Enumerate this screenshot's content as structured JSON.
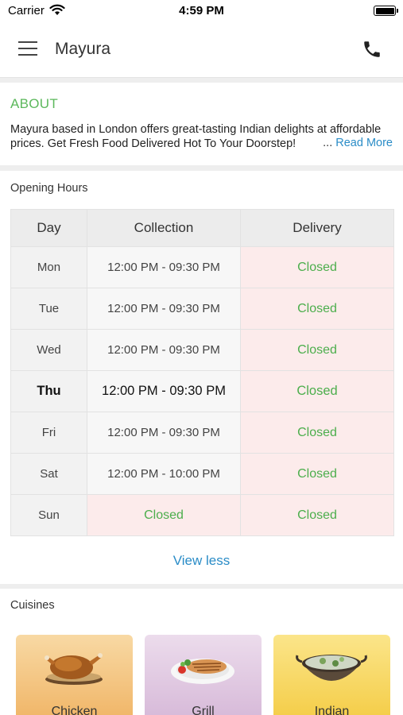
{
  "status_bar": {
    "carrier": "Carrier",
    "time": "4:59 PM"
  },
  "header": {
    "title": "Mayura",
    "menu_icon": "hamburger-menu-icon",
    "call_icon": "phone-icon"
  },
  "about": {
    "title": "ABOUT",
    "text": "Mayura based in London offers great-tasting Indian delights at affordable prices. Get Fresh Food Delivered Hot To Your Doorstep!",
    "ellipsis": "...",
    "read_more": "Read More"
  },
  "opening_hours": {
    "title": "Opening Hours",
    "columns": [
      "Day",
      "Collection",
      "Delivery"
    ],
    "rows": [
      {
        "day": "Mon",
        "collection": "12:00 PM - 09:30 PM",
        "delivery": "Closed",
        "collection_closed": false,
        "delivery_closed": true,
        "today": false
      },
      {
        "day": "Tue",
        "collection": "12:00 PM - 09:30 PM",
        "delivery": "Closed",
        "collection_closed": false,
        "delivery_closed": true,
        "today": false
      },
      {
        "day": "Wed",
        "collection": "12:00 PM - 09:30 PM",
        "delivery": "Closed",
        "collection_closed": false,
        "delivery_closed": true,
        "today": false
      },
      {
        "day": "Thu",
        "collection": "12:00 PM - 09:30 PM",
        "delivery": "Closed",
        "collection_closed": false,
        "delivery_closed": true,
        "today": true
      },
      {
        "day": "Fri",
        "collection": "12:00 PM - 09:30 PM",
        "delivery": "Closed",
        "collection_closed": false,
        "delivery_closed": true,
        "today": false
      },
      {
        "day": "Sat",
        "collection": "12:00 PM - 10:00 PM",
        "delivery": "Closed",
        "collection_closed": false,
        "delivery_closed": true,
        "today": false
      },
      {
        "day": "Sun",
        "collection": "Closed",
        "delivery": "Closed",
        "collection_closed": true,
        "delivery_closed": true,
        "today": false
      }
    ],
    "toggle_label": "View less"
  },
  "cuisines": {
    "title": "Cuisines",
    "items": [
      {
        "name": "Chicken",
        "icon": "roast-chicken-icon",
        "color": "#f6c88a"
      },
      {
        "name": "Grill",
        "icon": "grilled-fish-plate-icon",
        "color": "#e7d3e8"
      },
      {
        "name": "Indian",
        "icon": "curry-pot-icon",
        "color": "#f8dc6e"
      }
    ]
  },
  "colors": {
    "accent_green": "#5cb85c",
    "link_blue": "#2a8cc7",
    "closed_bg": "#fcebeb"
  }
}
